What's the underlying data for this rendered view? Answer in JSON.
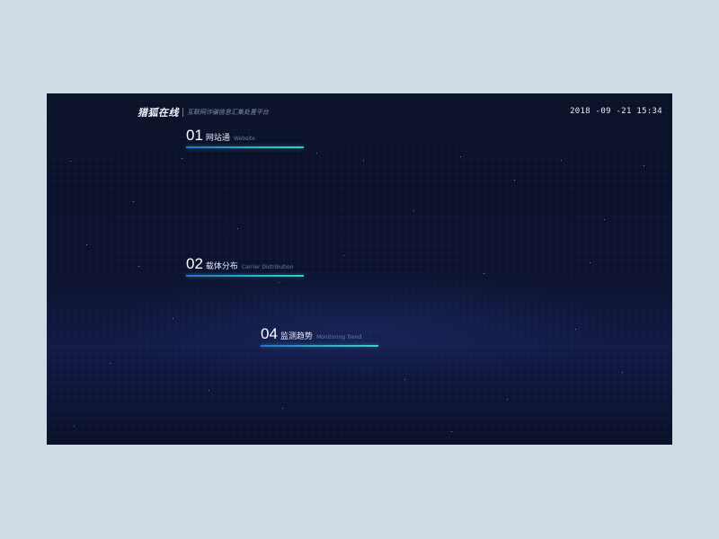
{
  "header": {
    "brand_name": "猎狐在线",
    "brand_subtitle": "互联网诈骗信息汇集处置平台",
    "datetime": "2018 -09 -21  15:34"
  },
  "sections": [
    {
      "number": "01",
      "title_cn": "网站通",
      "title_en": "Website"
    },
    {
      "number": "02",
      "title_cn": "载体分布",
      "title_en": "Carrier Distribution"
    },
    {
      "number": "04",
      "title_cn": "监测趋势",
      "title_en": "Monitoring Trend"
    }
  ],
  "colors": {
    "page_background": "#cfdce6",
    "dashboard_background": "#0c1227",
    "accent_underline": "#36d0c8"
  }
}
